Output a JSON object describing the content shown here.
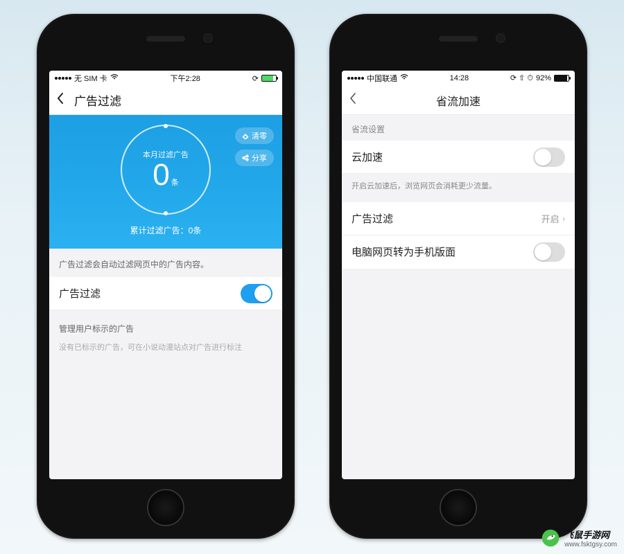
{
  "left": {
    "statusbar": {
      "carrier": "无 SIM 卡",
      "wifi": true,
      "time": "下午2:28",
      "extra": "⟳",
      "battery_pct": 80
    },
    "nav": {
      "title": "广告过滤"
    },
    "hero": {
      "ring_label": "本月过滤广告",
      "count": "0",
      "unit": "条",
      "total": "累计过滤广告：0条",
      "clear_label": "清零",
      "share_label": "分享"
    },
    "desc": "广告过滤会自动过滤网页中的广告内容。",
    "toggle_row": {
      "label": "广告过滤",
      "on": true
    },
    "manage_title": "管理用户标示的广告",
    "manage_empty": "没有已标示的广告，可在小说动漫站点对广告进行标注"
  },
  "right": {
    "statusbar": {
      "carrier": "中国联通",
      "wifi": true,
      "time": "14:28",
      "extra": "⟳ ⇧ ⏱",
      "battery_pct_text": "92%"
    },
    "nav": {
      "title": "省流加速"
    },
    "group_title": "省流设置",
    "cloud_row": {
      "label": "云加速",
      "on": false
    },
    "cloud_desc": "开启云加速后，浏览网页会消耗更少流量。",
    "adfilter_row": {
      "label": "广告过滤",
      "value": "开启"
    },
    "mobile_row": {
      "label": "电脑网页转为手机版面",
      "on": false
    }
  },
  "watermark": {
    "brand": "飞鼠手游网",
    "url": "www.fsktgsy.com"
  }
}
